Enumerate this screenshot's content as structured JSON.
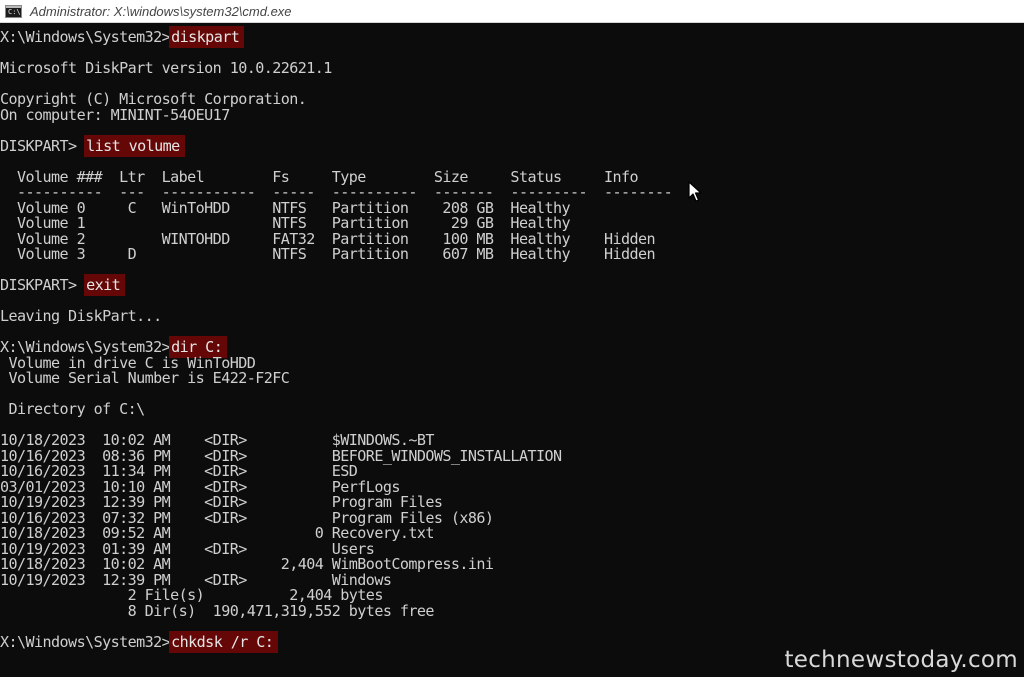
{
  "window": {
    "title": "Administrator: X:\\windows\\system32\\cmd.exe",
    "icon": "cmd-icon",
    "icon_glyph": "C:\\"
  },
  "console": {
    "lines": [
      {
        "prefix": "X:\\Windows\\System32>",
        "command": "diskpart",
        "text": ""
      },
      {
        "text": ""
      },
      {
        "text": "Microsoft DiskPart version 10.0.22621.1"
      },
      {
        "text": ""
      },
      {
        "text": "Copyright (C) Microsoft Corporation."
      },
      {
        "text": "On computer: MININT-54OEU17"
      },
      {
        "text": ""
      },
      {
        "prefix": "DISKPART> ",
        "command": "list volume",
        "text": ""
      },
      {
        "text": ""
      },
      {
        "text": "  Volume ###  Ltr  Label        Fs     Type        Size     Status     Info"
      },
      {
        "text": "  ----------  ---  -----------  -----  ----------  -------  ---------  --------"
      },
      {
        "text": "  Volume 0     C   WinToHDD     NTFS   Partition    208 GB  Healthy"
      },
      {
        "text": "  Volume 1                      NTFS   Partition     29 GB  Healthy"
      },
      {
        "text": "  Volume 2         WINTOHDD     FAT32  Partition    100 MB  Healthy    Hidden"
      },
      {
        "text": "  Volume 3     D                NTFS   Partition    607 MB  Healthy    Hidden"
      },
      {
        "text": ""
      },
      {
        "prefix": "DISKPART> ",
        "command": "exit",
        "text": ""
      },
      {
        "text": ""
      },
      {
        "text": "Leaving DiskPart..."
      },
      {
        "text": ""
      },
      {
        "prefix": "X:\\Windows\\System32>",
        "command": "dir C:",
        "text": ""
      },
      {
        "text": " Volume in drive C is WinToHDD"
      },
      {
        "text": " Volume Serial Number is E422-F2FC"
      },
      {
        "text": ""
      },
      {
        "text": " Directory of C:\\"
      },
      {
        "text": ""
      },
      {
        "text": "10/18/2023  10:02 AM    <DIR>          $WINDOWS.~BT"
      },
      {
        "text": "10/16/2023  08:36 PM    <DIR>          BEFORE_WINDOWS_INSTALLATION"
      },
      {
        "text": "10/16/2023  11:34 PM    <DIR>          ESD"
      },
      {
        "text": "03/01/2023  10:10 AM    <DIR>          PerfLogs"
      },
      {
        "text": "10/19/2023  12:39 PM    <DIR>          Program Files"
      },
      {
        "text": "10/16/2023  07:32 PM    <DIR>          Program Files (x86)"
      },
      {
        "text": "10/18/2023  09:52 AM                 0 Recovery.txt"
      },
      {
        "text": "10/19/2023  01:39 AM    <DIR>          Users"
      },
      {
        "text": "10/18/2023  10:02 AM             2,404 WimBootCompress.ini"
      },
      {
        "text": "10/19/2023  12:39 PM    <DIR>          Windows"
      },
      {
        "text": "               2 File(s)          2,404 bytes"
      },
      {
        "text": "               8 Dir(s)  190,471,319,552 bytes free"
      },
      {
        "text": ""
      },
      {
        "prefix": "X:\\Windows\\System32>",
        "command": "chkdsk /r C:",
        "text": ""
      }
    ]
  },
  "cursor": {
    "icon": "mouse-pointer-icon"
  },
  "watermark": {
    "text": "technewstoday.com"
  },
  "colors": {
    "background": "#0c0c0c",
    "text": "#cfcfcf",
    "command_highlight": "#650707",
    "titlebar": "#ffffff"
  }
}
